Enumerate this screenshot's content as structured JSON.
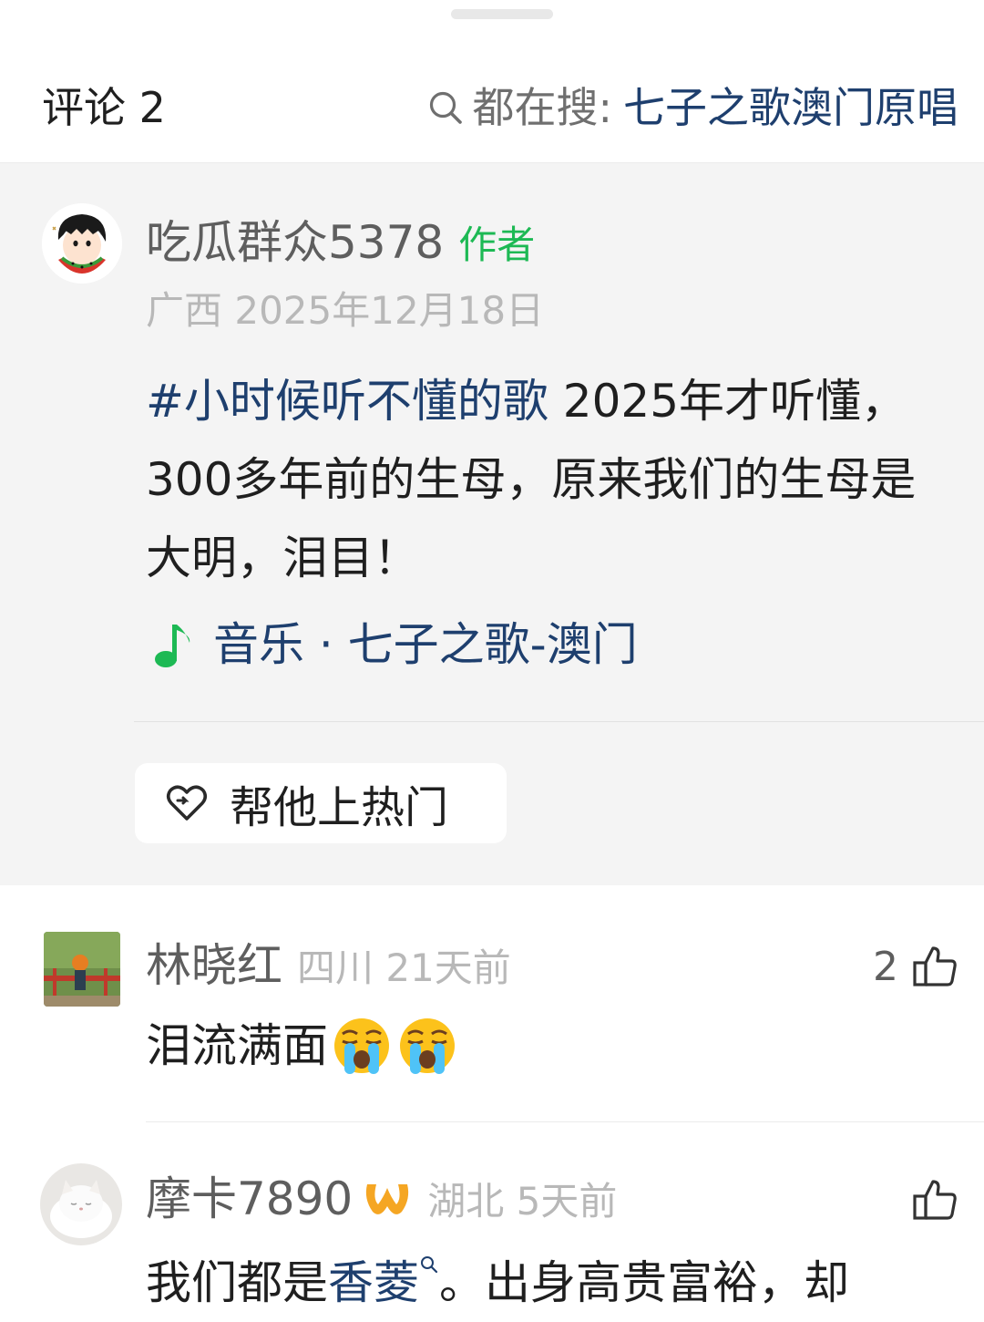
{
  "header": {
    "comment_count_label": "评论 2",
    "hot_search_label": "都在搜:",
    "hot_search_query": "七子之歌澳门原唱"
  },
  "author_comment": {
    "name": "吃瓜群众5378",
    "badge": "作者",
    "meta": "广西 2025年12月18日",
    "hashtag": "#小时候听不懂的歌",
    "text": " 2025年才听懂，300多年前的生母，原来我们的生母是大明，泪目！",
    "music_label": "音乐 · 七子之歌-澳门",
    "boost_label": "帮他上热门"
  },
  "comments": [
    {
      "name": "林晓红",
      "meta": "四川 21天前",
      "likes": "2",
      "text": "泪流满面",
      "emojis": [
        "loudly-crying-face",
        "loudly-crying-face"
      ]
    },
    {
      "name": "摩卡7890",
      "meta": "湖北 5天前",
      "likes": "",
      "text_link": "香菱",
      "text_prefix": "我们都是",
      "text_suffix": "。出身高贵富裕，却"
    }
  ],
  "colors": {
    "link": "#1e3f6e",
    "author_badge": "#1db954",
    "vip_badge": "#f5a623",
    "meta": "#b8b8b8",
    "author_bg": "#f4f4f4"
  },
  "icons": [
    "search-icon",
    "music-note-icon",
    "heart-share-icon",
    "thumbs-up-icon",
    "vip-badge-icon"
  ]
}
